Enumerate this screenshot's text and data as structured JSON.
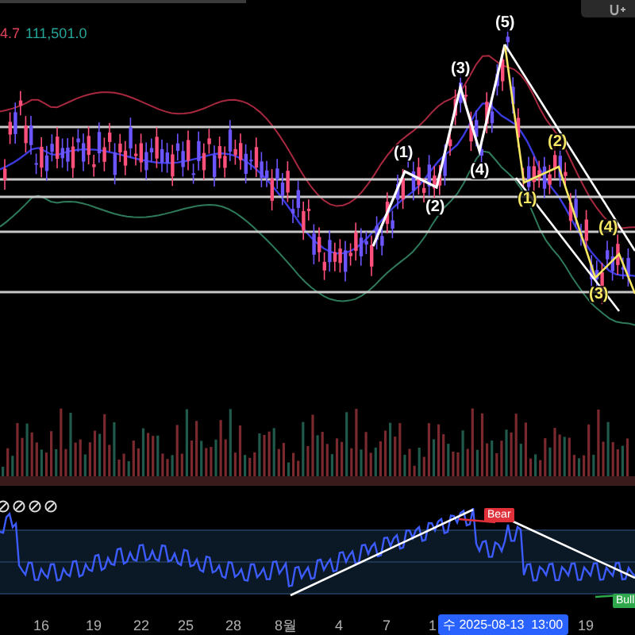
{
  "legend": {
    "value_1": "4.7",
    "value_2": "111,501.0"
  },
  "wave_labels": [
    {
      "text": "(1)",
      "color": "#ffffff"
    },
    {
      "text": "(2)",
      "color": "#ffffff"
    },
    {
      "text": "(3)",
      "color": "#ffffff"
    },
    {
      "text": "(4)",
      "color": "#ffffff"
    },
    {
      "text": "(5)",
      "color": "#ffffff"
    },
    {
      "text": "(1)",
      "color": "#f5e663"
    },
    {
      "text": "(2)",
      "color": "#f5e663"
    },
    {
      "text": "(3)",
      "color": "#f5e663"
    },
    {
      "text": "(4)",
      "color": "#f5e663"
    }
  ],
  "rsi": {
    "signals": [
      {
        "kind": "bear",
        "label": "Bear"
      },
      {
        "kind": "bull",
        "label": "Bull"
      }
    ]
  },
  "x_axis": {
    "labels": [
      "16",
      "19",
      "22",
      "25",
      "28",
      "8월",
      "4",
      "7",
      "1",
      "19"
    ],
    "crosshair_label": "수 2025-08-13  13:00"
  }
}
